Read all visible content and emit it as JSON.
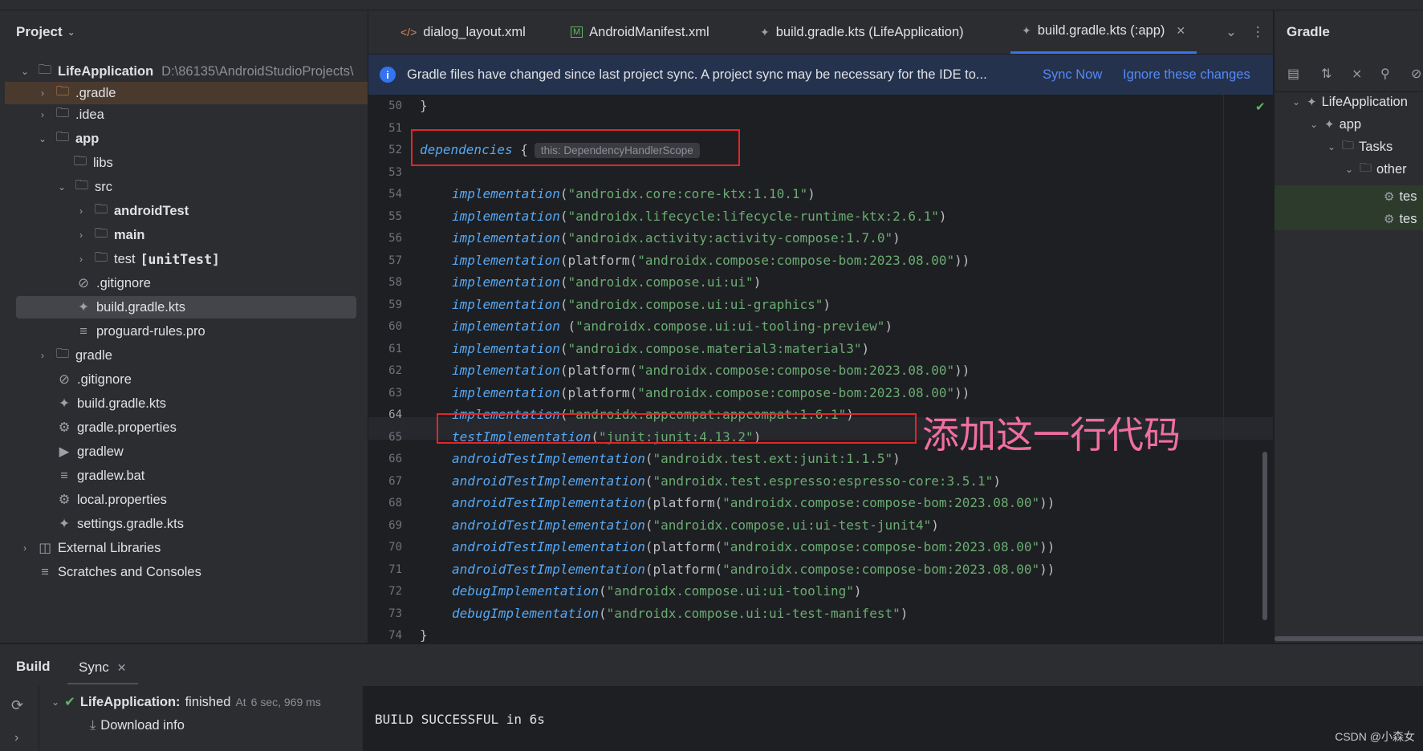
{
  "project_panel": {
    "title": "Project",
    "root_name": "LifeApplication",
    "root_path": "D:\\86135\\AndroidStudioProjects\\",
    "items": [
      {
        "label": ".gradle"
      },
      {
        "label": ".idea"
      },
      {
        "label": "app"
      },
      {
        "label": "libs"
      },
      {
        "label": "src"
      },
      {
        "label": "androidTest"
      },
      {
        "label": "main"
      },
      {
        "label": "test",
        "suffix": "[unitTest]"
      },
      {
        "label": ".gitignore"
      },
      {
        "label": "build.gradle.kts"
      },
      {
        "label": "proguard-rules.pro"
      },
      {
        "label": "gradle"
      },
      {
        "label": ".gitignore"
      },
      {
        "label": "build.gradle.kts"
      },
      {
        "label": "gradle.properties"
      },
      {
        "label": "gradlew"
      },
      {
        "label": "gradlew.bat"
      },
      {
        "label": "local.properties"
      },
      {
        "label": "settings.gradle.kts"
      },
      {
        "label": "External Libraries"
      },
      {
        "label": "Scratches and Consoles"
      }
    ]
  },
  "tabs": [
    {
      "label": "dialog_layout.xml"
    },
    {
      "label": "AndroidManifest.xml"
    },
    {
      "label": "build.gradle.kts (LifeApplication)"
    },
    {
      "label": "build.gradle.kts (:app)"
    }
  ],
  "banner": {
    "message": "Gradle files have changed since last project sync. A project sync may be necessary for the IDE to...",
    "sync_now": "Sync Now",
    "ignore": "Ignore these changes"
  },
  "code": {
    "lines": [
      {
        "n": "50",
        "text": "}"
      },
      {
        "n": "51",
        "text": ""
      },
      {
        "n": "52",
        "kw": "dependencies",
        "rest": " {",
        "hint": "this: DependencyHandlerScope"
      },
      {
        "n": "53",
        "text": ""
      },
      {
        "n": "54",
        "kw": "implementation",
        "pre": "(",
        "str": "\"androidx.core:core-ktx:1.10.1\"",
        "post": ")"
      },
      {
        "n": "55",
        "kw": "implementation",
        "pre": "(",
        "str": "\"androidx.lifecycle:lifecycle-runtime-ktx:2.6.1\"",
        "post": ")"
      },
      {
        "n": "56",
        "kw": "implementation",
        "pre": "(",
        "str": "\"androidx.activity:activity-compose:1.7.0\"",
        "post": ")"
      },
      {
        "n": "57",
        "kw": "implementation",
        "pre": "(platform(",
        "str": "\"androidx.compose:compose-bom:2023.08.00\"",
        "post": "))"
      },
      {
        "n": "58",
        "kw": "implementation",
        "pre": "(",
        "str": "\"androidx.compose.ui:ui\"",
        "post": ")"
      },
      {
        "n": "59",
        "kw": "implementation",
        "pre": "(",
        "str": "\"androidx.compose.ui:ui-graphics\"",
        "post": ")"
      },
      {
        "n": "60",
        "kw": "implementation",
        "pre": " (",
        "str": "\"androidx.compose.ui:ui-tooling-preview\"",
        "post": ")"
      },
      {
        "n": "61",
        "kw": "implementation",
        "pre": "(",
        "str": "\"androidx.compose.material3:material3\"",
        "post": ")"
      },
      {
        "n": "62",
        "kw": "implementation",
        "pre": "(platform(",
        "str": "\"androidx.compose:compose-bom:2023.08.00\"",
        "post": "))"
      },
      {
        "n": "63",
        "kw": "implementation",
        "pre": "(platform(",
        "str": "\"androidx.compose:compose-bom:2023.08.00\"",
        "post": "))"
      },
      {
        "n": "64",
        "kw": "implementation",
        "pre": "(",
        "str": "\"androidx.appcompat:appcompat:1.6.1\"",
        "post": ")"
      },
      {
        "n": "65",
        "kw": "testImplementation",
        "pre": "(",
        "str": "\"junit:junit:4.13.2\"",
        "post": ")"
      },
      {
        "n": "66",
        "kw": "androidTestImplementation",
        "pre": "(",
        "str": "\"androidx.test.ext:junit:1.1.5\"",
        "post": ")"
      },
      {
        "n": "67",
        "kw": "androidTestImplementation",
        "pre": "(",
        "str": "\"androidx.test.espresso:espresso-core:3.5.1\"",
        "post": ")"
      },
      {
        "n": "68",
        "kw": "androidTestImplementation",
        "pre": "(platform(",
        "str": "\"androidx.compose:compose-bom:2023.08.00\"",
        "post": "))"
      },
      {
        "n": "69",
        "kw": "androidTestImplementation",
        "pre": "(",
        "str": "\"androidx.compose.ui:ui-test-junit4\"",
        "post": ")"
      },
      {
        "n": "70",
        "kw": "androidTestImplementation",
        "pre": "(platform(",
        "str": "\"androidx.compose:compose-bom:2023.08.00\"",
        "post": "))"
      },
      {
        "n": "71",
        "kw": "androidTestImplementation",
        "pre": "(platform(",
        "str": "\"androidx.compose:compose-bom:2023.08.00\"",
        "post": "))"
      },
      {
        "n": "72",
        "kw": "debugImplementation",
        "pre": "(",
        "str": "\"androidx.compose.ui:ui-tooling\"",
        "post": ")"
      },
      {
        "n": "73",
        "kw": "debugImplementation",
        "pre": "(",
        "str": "\"androidx.compose.ui:ui-test-manifest\"",
        "post": ")"
      },
      {
        "n": "74",
        "text": "}"
      }
    ]
  },
  "annotation": "添加这一行代码",
  "gradle_panel": {
    "title": "Gradle",
    "items": [
      {
        "label": "LifeApplication"
      },
      {
        "label": "app"
      },
      {
        "label": "Tasks"
      },
      {
        "label": "other"
      },
      {
        "label": "tes"
      },
      {
        "label": "tes"
      }
    ]
  },
  "bottom": {
    "build_tab": "Build",
    "sync_tab": "Sync",
    "tree_root": "LifeApplication:",
    "tree_status": "finished",
    "tree_time": "At ",
    "tree_duration": "6 sec, 969 ms",
    "download_info": "Download info",
    "console": "BUILD SUCCESSFUL in 6s"
  },
  "watermark": "CSDN @小森女"
}
